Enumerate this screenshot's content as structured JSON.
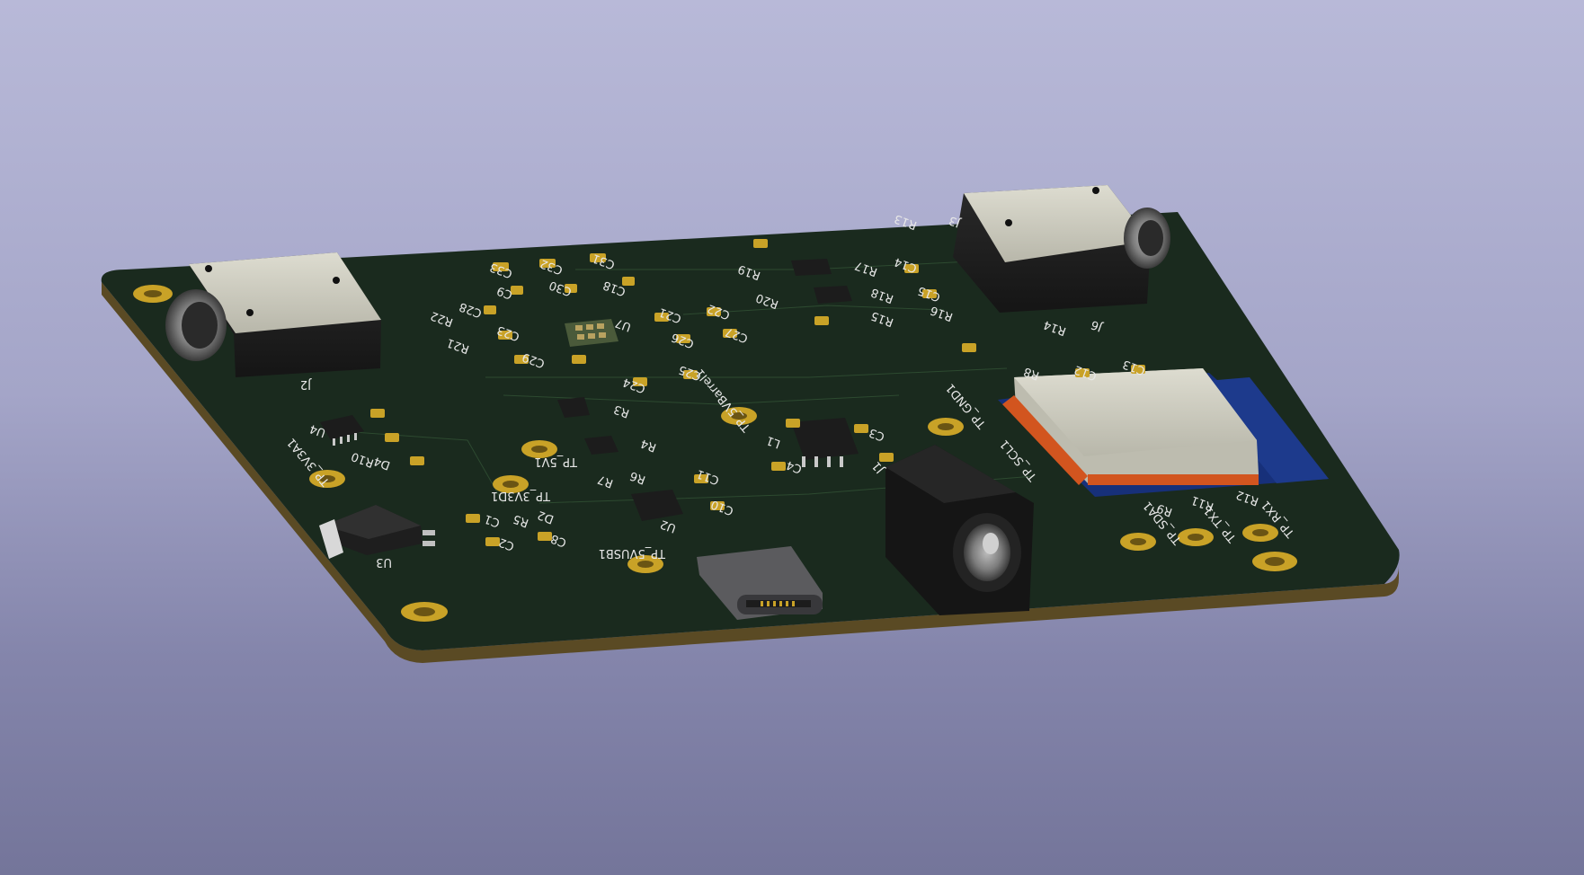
{
  "viewer": {
    "view_type": "3D PCB render",
    "background_top": "#b8b9d8",
    "background_bottom": "#74759a"
  },
  "board": {
    "soldermask_color": "#1a2a1e",
    "edge_color": "#5a4a24",
    "pad_color": "#c9a227"
  },
  "labels": {
    "J2": "J2",
    "U4": "U4",
    "R10": "R10",
    "D4": "D4",
    "TP_3V3A1": "TP_3V3A1",
    "U3": "U3",
    "C1": "C1",
    "C2": "C2",
    "R5": "R5",
    "D2": "D2",
    "C8": "C8",
    "TP_3V3D1": "TP_3V3D1",
    "TP_5V1": "TP_5V1",
    "TP_5VUSB1": "TP_5VUSB1",
    "R6": "R6",
    "R7": "R7",
    "U2": "U2",
    "C10": "C10",
    "C11": "C11",
    "R3": "R3",
    "R4": "R4",
    "TP_5VBarrel1": "TP_5VBarrel1",
    "L1": "L1",
    "C3": "C3",
    "C4": "C4",
    "TP_GND1": "TP_GND1",
    "TP_SCL1": "TP_SCL1",
    "TP_SDA1": "TP_SDA1",
    "TP_TX1": "TP_TX1",
    "TP_RX1": "TP_RX1",
    "R9": "R9",
    "R11": "R11",
    "R12": "R12",
    "R8": "R8",
    "R14": "R14",
    "J6": "J6",
    "R15": "R15",
    "R16": "R16",
    "R17": "R17",
    "R18": "R18",
    "R19": "R19",
    "R20": "R20",
    "R13": "R13",
    "R21": "R21",
    "R22": "R22",
    "C14": "C14",
    "C15": "C15",
    "U7": "U7",
    "C22": "C22",
    "C24": "C24",
    "C25": "C25",
    "C26": "C26",
    "C27": "C27",
    "C28": "C28",
    "C29": "C29",
    "C30": "C30",
    "C31": "C31",
    "C32": "C32",
    "C33": "C33",
    "C21": "C21",
    "C23": "C23",
    "C9": "C9",
    "C12": "C12",
    "C13": "C13",
    "C18": "C18",
    "J3": "J3",
    "J1": "J1"
  }
}
